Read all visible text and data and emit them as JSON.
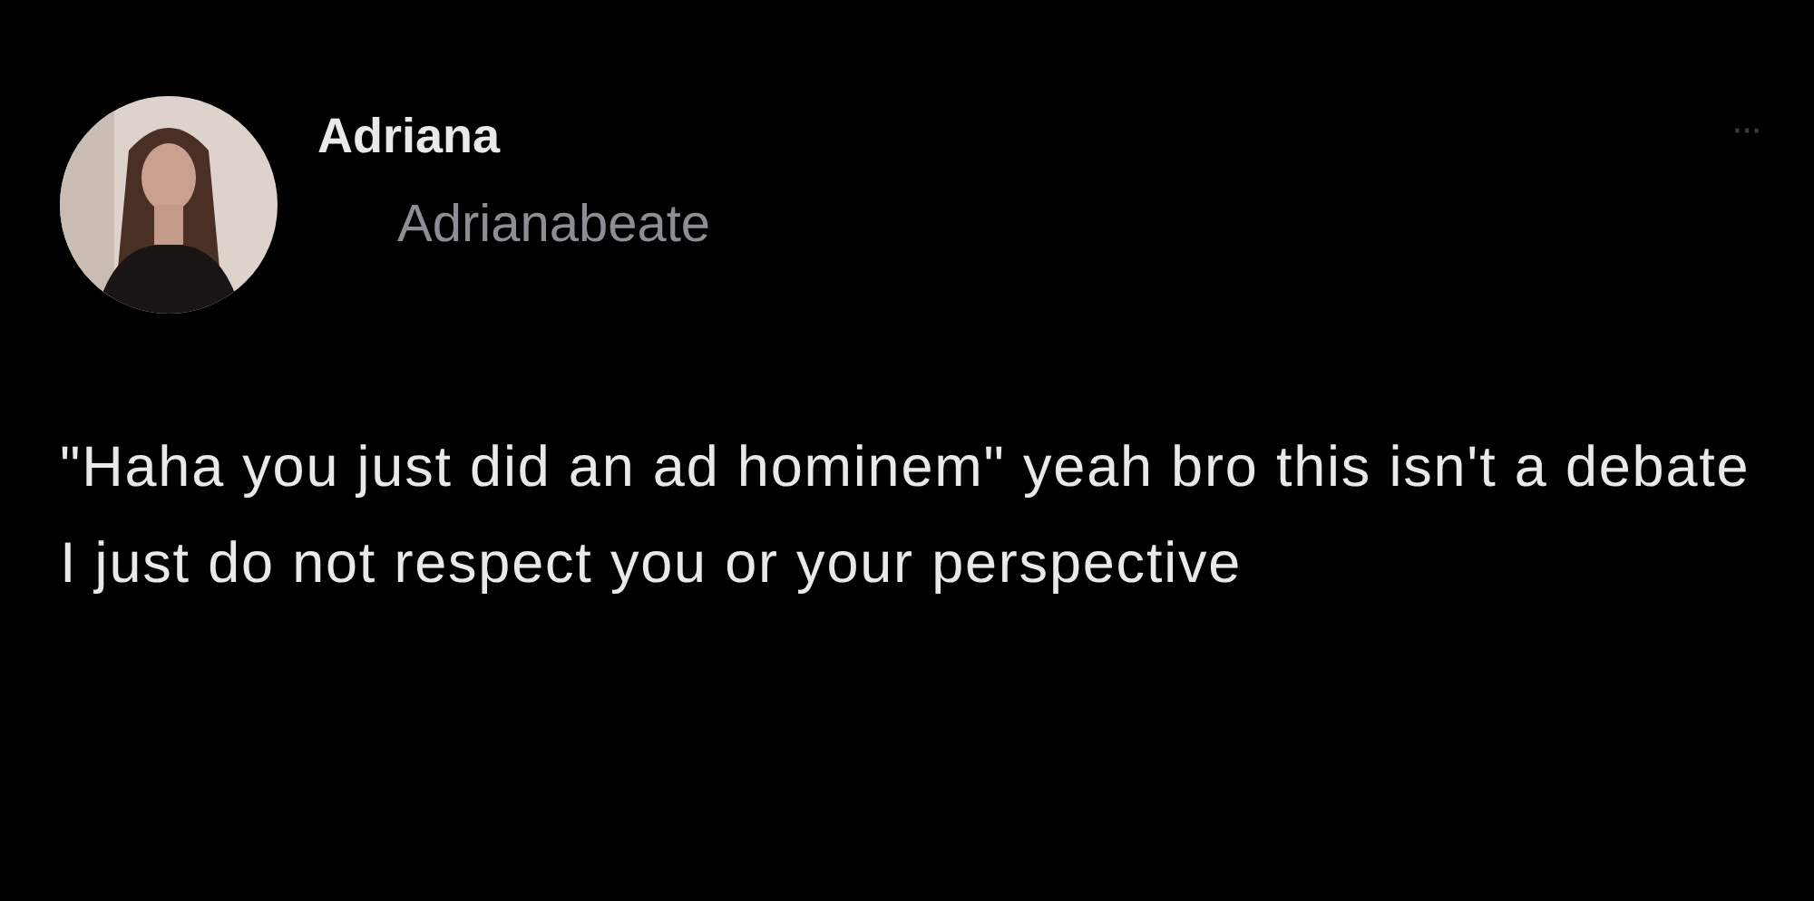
{
  "post": {
    "author": {
      "name": "Adriana",
      "handle": "Adrianabeate"
    },
    "menu_icon": "···",
    "text": "\"Haha you just did an ad hominem\" yeah bro this isn't a debate I just do not respect you or your perspective"
  }
}
